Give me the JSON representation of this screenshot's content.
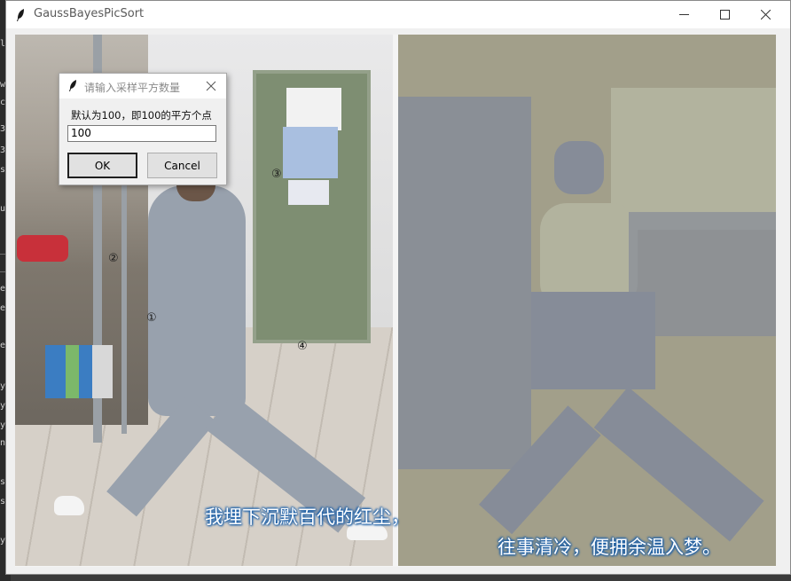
{
  "window": {
    "title": "GaussBayesPicSort"
  },
  "desktop_strip_fragments": [
    "le",
    "w",
    "c",
    "3",
    "3",
    "s",
    "u",
    "_",
    "_",
    "e",
    "e",
    "e",
    "y",
    "y",
    "y",
    "n",
    "s",
    "s",
    "y"
  ],
  "image": {
    "markers": [
      "③",
      "②",
      "①",
      "④"
    ],
    "subtitle_left": "我埋下沉默百代的红尘，",
    "subtitle_right": "往事清冷，便拥余温入梦。"
  },
  "dialog": {
    "title": "请输入采样平方数量",
    "label": "默认为100，即100的平方个点",
    "input_value": "100",
    "ok_label": "OK",
    "cancel_label": "Cancel"
  },
  "colors": {
    "subtitle_outline": "#1b5fa8",
    "processed_tan": "#a29f8a",
    "processed_slate": "#868c98"
  }
}
